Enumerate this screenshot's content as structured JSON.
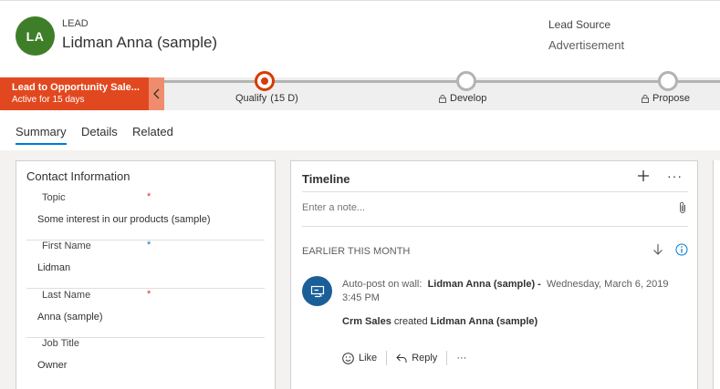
{
  "header": {
    "avatar_initials": "LA",
    "entity_type": "LEAD",
    "record_name": "Lidman Anna (sample)",
    "lead_source_label": "Lead Source",
    "lead_source_value": "Advertisement",
    "avatar_color": "#3f7e28"
  },
  "process": {
    "flag_title": "Lead to Opportunity Sale...",
    "flag_subtitle": "Active for 15 days",
    "flag_color": "#e2481f",
    "stages": [
      {
        "label": "Qualify",
        "duration": "(15 D)",
        "active": true,
        "locked": false
      },
      {
        "label": "Develop",
        "active": false,
        "locked": true
      },
      {
        "label": "Propose",
        "active": false,
        "locked": true
      }
    ]
  },
  "tabs": [
    {
      "label": "Summary",
      "active": true
    },
    {
      "label": "Details",
      "active": false
    },
    {
      "label": "Related",
      "active": false
    }
  ],
  "contact": {
    "title": "Contact Information",
    "fields": [
      {
        "label": "Topic",
        "required": "*",
        "value": "Some interest in our products (sample)"
      },
      {
        "label": "First Name",
        "required": "*",
        "value": "Lidman"
      },
      {
        "label": "Last Name",
        "required": "*",
        "value": "Anna (sample)"
      },
      {
        "label": "Job Title",
        "required": "",
        "value": "Owner"
      }
    ]
  },
  "timeline": {
    "title": "Timeline",
    "add_icon": "plus-icon",
    "more_label": "···",
    "note_placeholder": "Enter a note...",
    "section_heading": "EARLIER THIS MONTH",
    "post": {
      "prefix": "Auto-post on wall:",
      "subject": "Lidman Anna (sample) -",
      "timestamp": "Wednesday, March 6, 2019 3:45 PM",
      "author": "Crm Sales",
      "verb": "created",
      "object": "Lidman Anna (sample)",
      "like_label": "Like",
      "reply_label": "Reply",
      "more_label": "···"
    }
  },
  "colors": {
    "accent": "#0078d4",
    "active_stage": "#d83b01",
    "post_avatar": "#1b5f98"
  }
}
